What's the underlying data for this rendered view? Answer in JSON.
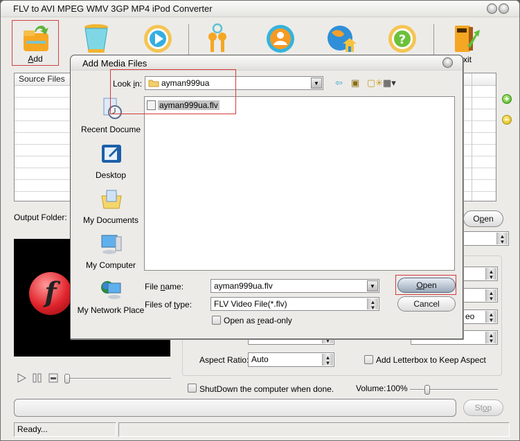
{
  "window": {
    "title": "FLV to AVI MPEG WMV 3GP MP4 iPod Converter"
  },
  "toolbar": {
    "items": [
      {
        "label": "Add",
        "icon": "add-folder-icon",
        "selected": true
      },
      {
        "label": "",
        "icon": "clear-cup-icon"
      },
      {
        "label": "",
        "icon": "play-convert-icon"
      },
      {
        "label": "",
        "icon": "keys-register-icon"
      },
      {
        "label": "",
        "icon": "user-icon"
      },
      {
        "label": "",
        "icon": "globe-home-icon"
      },
      {
        "label": "",
        "icon": "help-icon"
      },
      {
        "label": "Exit",
        "visible_text": "xit",
        "icon": "exit-door-icon"
      }
    ]
  },
  "source_list": {
    "header": "Source Files",
    "rows": 10
  },
  "side_buttons": {
    "add": "+",
    "remove": "−"
  },
  "output": {
    "label": "Output Folder:",
    "open_button": "Open",
    "open_accel": "p"
  },
  "settings": {
    "partial_value": "eo",
    "aspect_label": "Aspect Ratio:",
    "aspect_value": "Auto",
    "letterbox_label": "Add Letterbox to Keep Aspect",
    "letterbox_checked": false,
    "shutdown_label": "ShutDown the computer when done.",
    "shutdown_checked": false,
    "volume_label": "Volume:",
    "volume_value": "100%",
    "volume_fraction": 0.2
  },
  "player": {
    "seek_fraction": 0.0
  },
  "progress": {
    "stop_button": "Stop",
    "fraction": 0
  },
  "status": {
    "text": "Ready...",
    "right": ""
  },
  "dialog": {
    "title": "Add Media Files",
    "look_in_label": "Look in:",
    "look_in_value": "ayman999ua",
    "places": [
      {
        "label": "My Recent Documents",
        "visible_text": "Recent Docume",
        "icon": "recent-documents-icon"
      },
      {
        "label": "Desktop",
        "icon": "desktop-icon"
      },
      {
        "label": "My Documents",
        "icon": "my-documents-icon"
      },
      {
        "label": "My Computer",
        "icon": "my-computer-icon"
      },
      {
        "label": "My Network Places",
        "visible_text": "My Network Place",
        "icon": "network-places-icon"
      }
    ],
    "files": [
      {
        "name": "ayman999ua.flv",
        "selected": true
      }
    ],
    "file_name_label": "File name:",
    "file_name_value": "ayman999ua.flv",
    "file_type_label": "Files of type:",
    "file_type_value": "FLV Video File(*.flv)",
    "readonly_label": "Open as read-only",
    "readonly_checked": false,
    "open_button": "Open",
    "cancel_button": "Cancel"
  }
}
